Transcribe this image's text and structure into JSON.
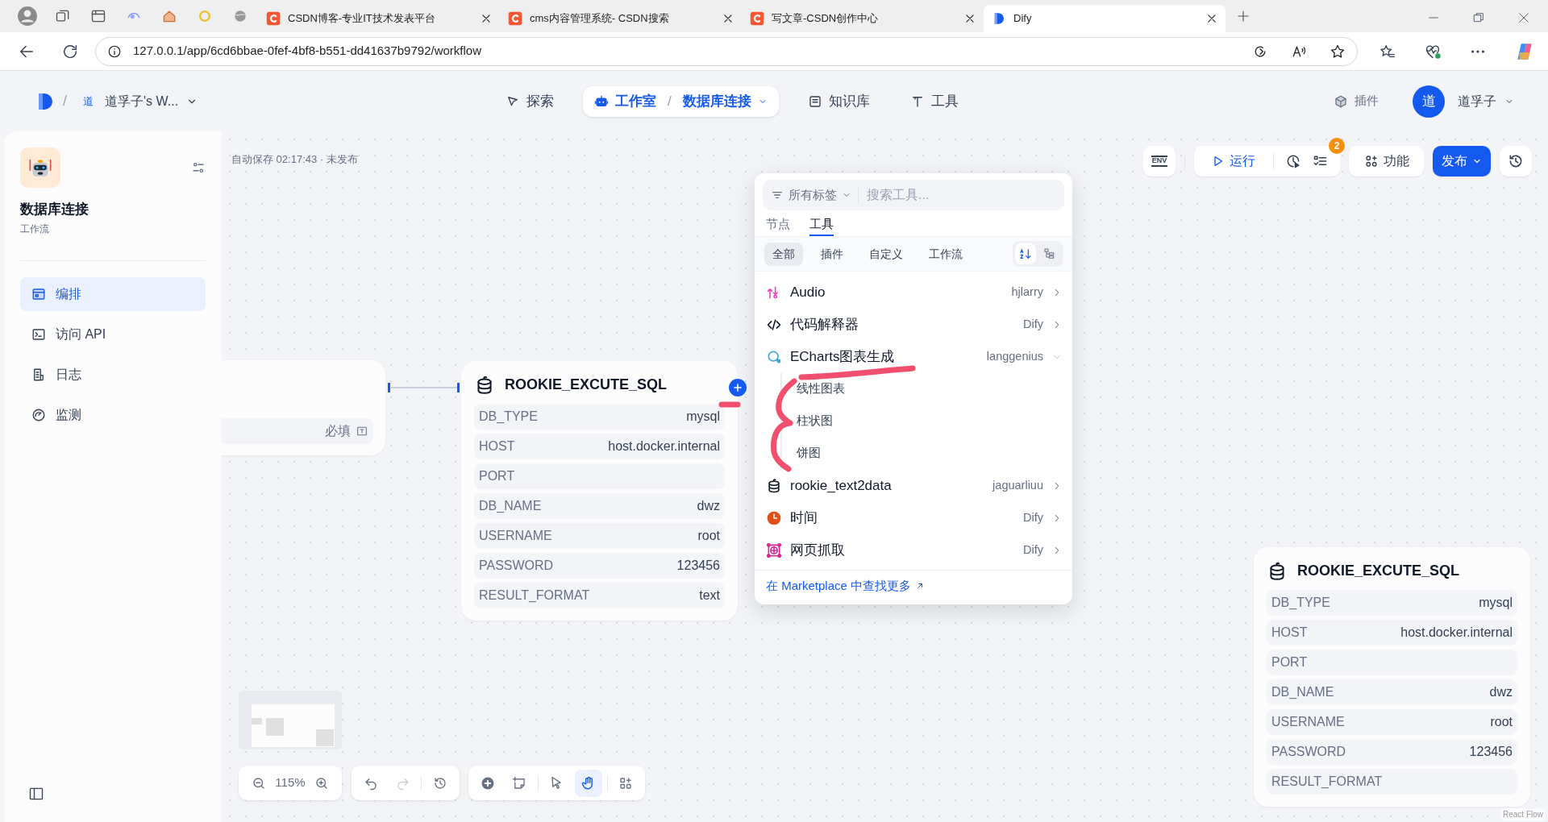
{
  "browser": {
    "tabs": [
      {
        "title": "CSDN博客-专业IT技术发表平台",
        "kind": "csdn",
        "selected": false
      },
      {
        "title": "cms内容管理系统- CSDN搜索",
        "kind": "csdn",
        "selected": false
      },
      {
        "title": "写文章-CSDN创作中心",
        "kind": "csdn",
        "selected": false
      },
      {
        "title": "Dify",
        "kind": "dify",
        "selected": true
      }
    ],
    "address": "127.0.0.1/app/6cd6bbae-0fef-4bf8-b551-dd41637b9792/workflow"
  },
  "header": {
    "separator": "/",
    "workspace_badge": "道",
    "workspace": "道孚子's W...",
    "nav": [
      {
        "label": "探索",
        "kind": "explore",
        "selected": false
      },
      {
        "label": "工作室",
        "kind": "studio",
        "selected": true,
        "separator": "/",
        "current": "数据库连接"
      },
      {
        "label": "知识库",
        "kind": "knowledge",
        "selected": false
      },
      {
        "label": "工具",
        "kind": "tools",
        "selected": false
      }
    ],
    "plugins": "插件",
    "avatar": "道",
    "user": "道孚子"
  },
  "sidebar": {
    "app_name": "数据库连接",
    "app_type": "工作流",
    "items": [
      {
        "label": "编排",
        "kind": "layout",
        "selected": true
      },
      {
        "label": "访问 API",
        "kind": "terminal",
        "selected": false
      },
      {
        "label": "日志",
        "kind": "doc",
        "selected": false
      },
      {
        "label": "监测",
        "kind": "gauge",
        "selected": false
      }
    ]
  },
  "canvas": {
    "autosave": "自动保存 02:17:43 · 未发布",
    "toolbar": {
      "env": "ENV",
      "run": "运行",
      "checklist_count": "2",
      "features": "功能",
      "publish": "发布"
    },
    "input_node": {
      "required": "必填"
    },
    "sql_nodes": [
      {
        "title": "ROOKIE_EXCUTE_SQL",
        "fields": [
          {
            "name": "DB_TYPE",
            "value": "mysql"
          },
          {
            "name": "HOST",
            "value": "host.docker.internal"
          },
          {
            "name": "PORT"
          },
          {
            "name": "DB_NAME",
            "value": "dwz"
          },
          {
            "name": "USERNAME",
            "value": "root"
          },
          {
            "name": "PASSWORD",
            "value": "123456"
          },
          {
            "name": "RESULT_FORMAT",
            "value": "text"
          }
        ]
      },
      {
        "title": "ROOKIE_EXCUTE_SQL",
        "fields": [
          {
            "name": "DB_TYPE",
            "value": "mysql"
          },
          {
            "name": "HOST",
            "value": "host.docker.internal"
          },
          {
            "name": "PORT"
          },
          {
            "name": "DB_NAME",
            "value": "dwz"
          },
          {
            "name": "USERNAME",
            "value": "root"
          },
          {
            "name": "PASSWORD",
            "value": "123456"
          },
          {
            "name": "RESULT_FORMAT"
          }
        ]
      }
    ],
    "tool_picker": {
      "filter": "所有标签",
      "search_placeholder": "搜索工具...",
      "tabs": [
        {
          "label": "节点",
          "selected": false
        },
        {
          "label": "工具",
          "selected": true
        }
      ],
      "categories": [
        {
          "label": "全部",
          "selected": true
        },
        {
          "label": "插件",
          "selected": false
        },
        {
          "label": "自定义",
          "selected": false
        },
        {
          "label": "工作流",
          "selected": false
        }
      ],
      "tools": [
        {
          "name": "Audio",
          "provider": "hjlarry",
          "kind": "audio",
          "expanded": false
        },
        {
          "name": "代码解释器",
          "provider": "Dify",
          "kind": "code",
          "expanded": false
        },
        {
          "name": "ECharts图表生成",
          "provider": "langgenius",
          "kind": "echarts",
          "expanded": true,
          "children": [
            "线性图表",
            "柱状图",
            "饼图"
          ]
        },
        {
          "name": "rookie_text2data",
          "provider": "jaguarliuu",
          "kind": "database",
          "expanded": false
        },
        {
          "name": "时间",
          "provider": "Dify",
          "kind": "clock",
          "expanded": false
        },
        {
          "name": "网页抓取",
          "provider": "Dify",
          "kind": "web",
          "expanded": false
        }
      ],
      "footer": "在 Marketplace 中查找更多"
    },
    "zoom": "115%",
    "history": {
      "undo_disabled": false,
      "redo_disabled": true
    },
    "modes": [
      {
        "kind": "pointer",
        "selected": false
      },
      {
        "kind": "hand",
        "selected": true
      }
    ],
    "attribution": "React Flow"
  }
}
